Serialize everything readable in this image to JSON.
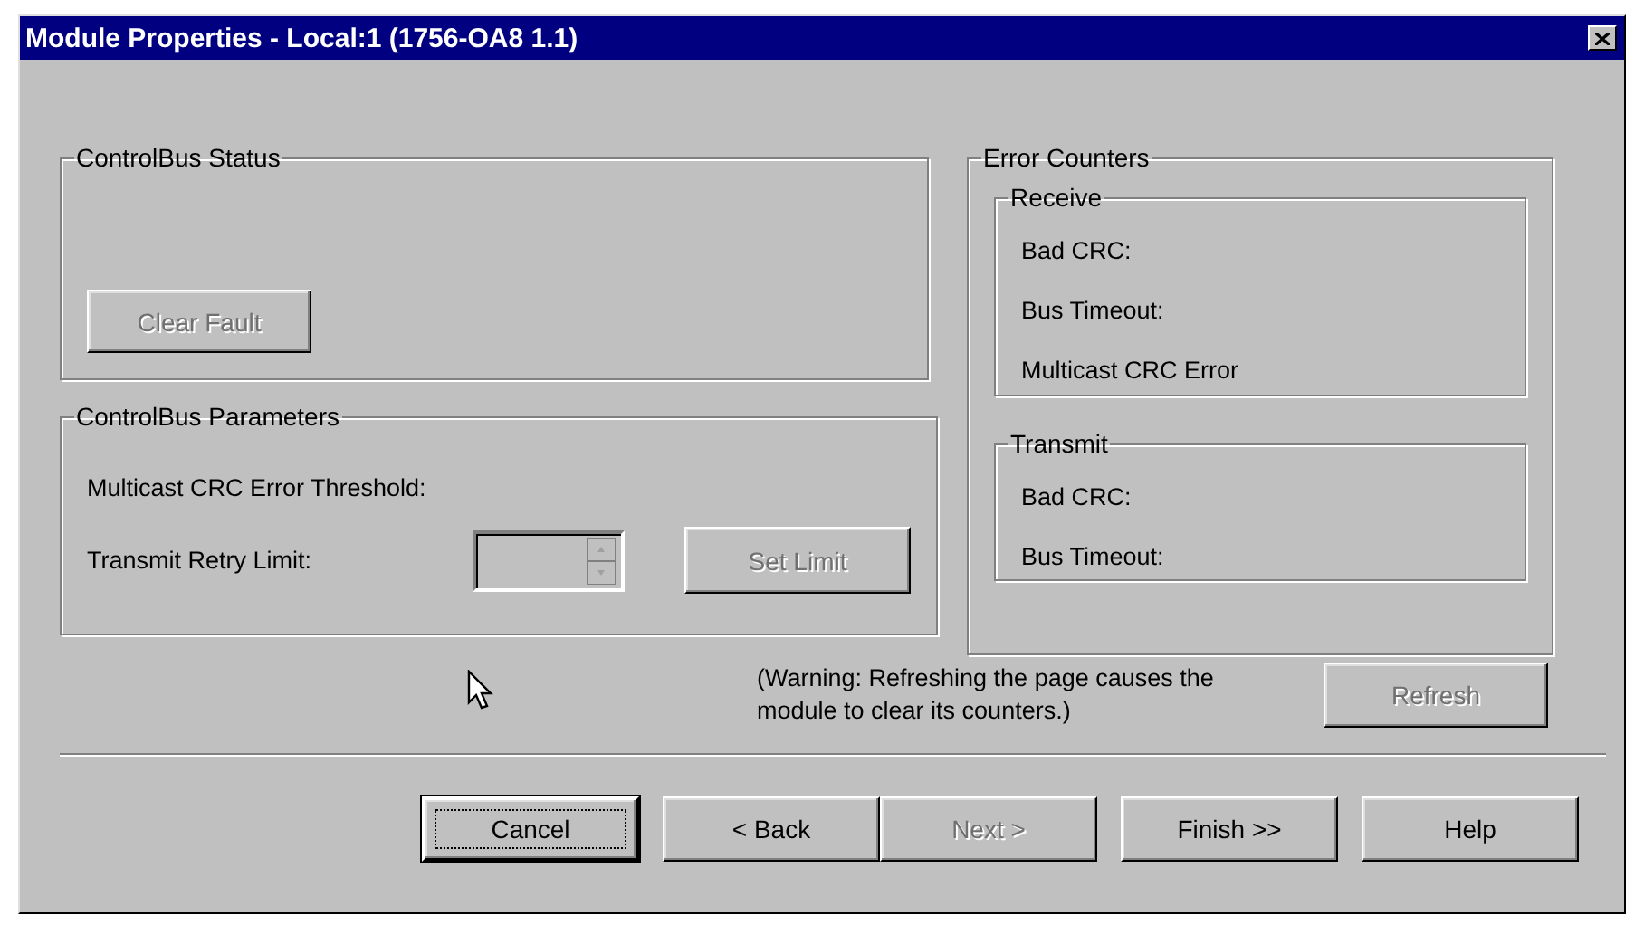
{
  "window": {
    "title": "Module Properties - Local:1 (1756-OA8 1.1)"
  },
  "controlbus_status": {
    "title": "ControlBus Status",
    "clear_fault": {
      "label": "Clear Fault",
      "disabled": true
    }
  },
  "controlbus_parameters": {
    "title": "ControlBus Parameters",
    "threshold_label": "Multicast CRC Error Threshold:",
    "retry_label": "Transmit Retry Limit:",
    "retry_field": {
      "disabled": true
    },
    "set_limit": {
      "label": "Set Limit",
      "disabled": true
    }
  },
  "error_counters": {
    "title": "Error Counters",
    "groups": [
      {
        "title": "Receive",
        "items": [
          "Bad CRC:",
          "Bus Timeout:",
          "Multicast CRC Error"
        ]
      },
      {
        "title": "Transmit",
        "items": [
          "Bad CRC:",
          "Bus Timeout:"
        ]
      }
    ]
  },
  "warning": "(Warning: Refreshing the page causes the module to clear its counters.)",
  "refresh": {
    "label": "Refresh",
    "disabled": true
  },
  "buttons": [
    {
      "label": "Cancel",
      "disabled": false,
      "default": true
    },
    {
      "label": "< Back",
      "disabled": false,
      "default": false
    },
    {
      "label": "Next >",
      "disabled": true,
      "default": false
    },
    {
      "label": "Finish >>",
      "disabled": false,
      "default": false
    },
    {
      "label": "Help",
      "disabled": false,
      "default": false
    }
  ]
}
